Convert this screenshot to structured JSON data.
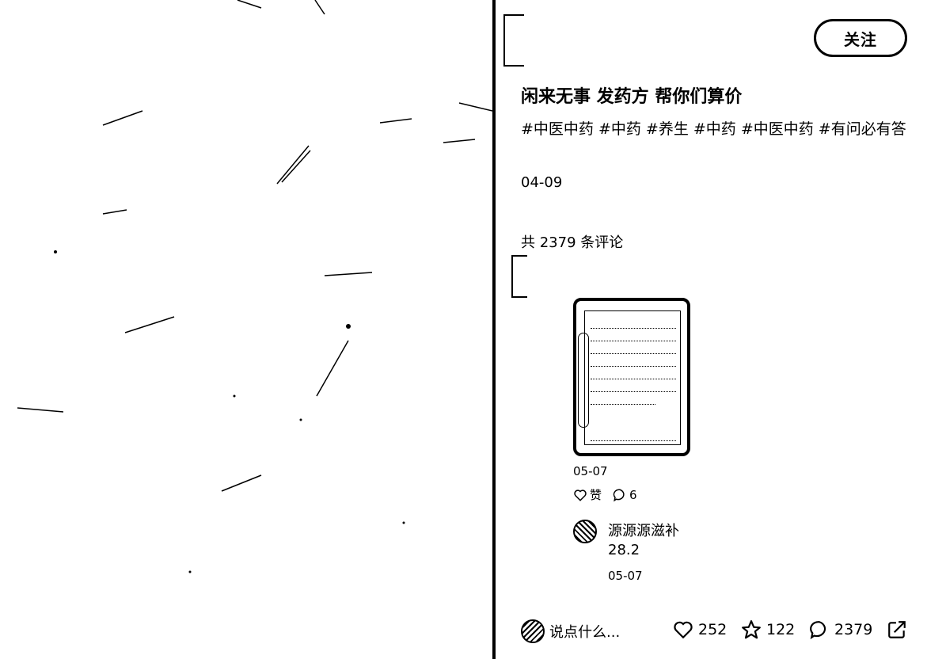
{
  "post": {
    "follow_label": "关注",
    "title": "闲来无事 发药方 帮你们算价",
    "tags": "#中医中药 #中药 #养生 #中药 #中医中药 #有问必有答",
    "date": "04-09",
    "comment_total": "共 2379 条评论"
  },
  "comment": {
    "date": "05-07",
    "like_label": "赞",
    "reply_count": "6"
  },
  "reply": {
    "name": "源源源滋补",
    "text": "28.2",
    "date": "05-07"
  },
  "bottom_bar": {
    "input_placeholder": "说点什么...",
    "likes": "252",
    "stars": "122",
    "comments": "2379"
  },
  "icons": {
    "like": "heart-icon",
    "star": "star-icon",
    "comment": "comment-bubble-icon",
    "share": "share-icon"
  }
}
